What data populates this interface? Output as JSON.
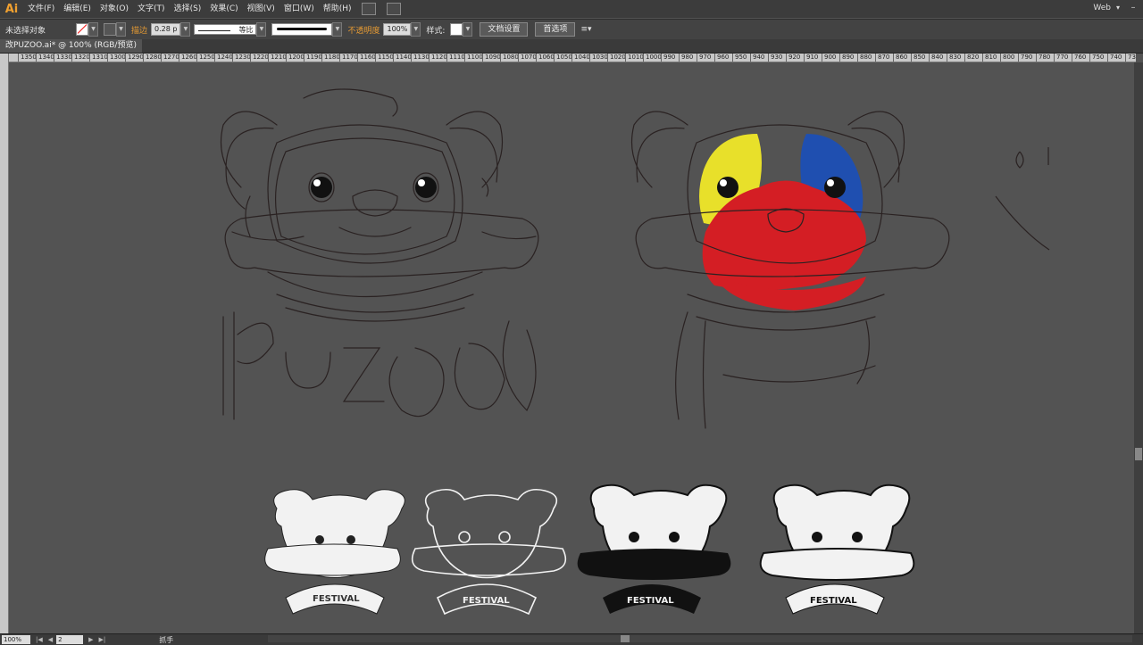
{
  "app": {
    "logo": "Ai",
    "workspace": "Web"
  },
  "menu": [
    "文件(F)",
    "编辑(E)",
    "对象(O)",
    "文字(T)",
    "选择(S)",
    "效果(C)",
    "视图(V)",
    "窗口(W)",
    "帮助(H)"
  ],
  "control": {
    "selection": "未选择对象",
    "stroke_label": "描边",
    "stroke_weight": "0.28 p",
    "profile": "等比",
    "opacity_label": "不透明度",
    "opacity_value": "100%",
    "style_label": "样式:",
    "doc_setup": "文档设置",
    "prefs": "首选项"
  },
  "document": {
    "tab": "改PUZOO.ai* @ 100% (RGB/预览)"
  },
  "ruler": {
    "start": 1350,
    "step": 10,
    "labels": [
      1350,
      1340,
      1330,
      1320,
      1310,
      1300,
      1290,
      1280,
      1270,
      1260,
      1250,
      1240,
      1230,
      1220,
      1210,
      1200,
      1190,
      1180,
      1170,
      1160,
      1150,
      1140,
      1130,
      1120,
      1110,
      1100,
      1090,
      1080,
      1070,
      1060,
      1050,
      1040,
      1030,
      1020,
      1010,
      1000,
      990,
      980,
      970,
      960,
      950,
      940,
      930,
      920,
      910,
      900,
      890,
      880,
      870,
      860,
      850,
      840,
      830,
      820,
      810,
      800,
      790,
      780,
      770,
      760,
      750,
      740,
      730
    ]
  },
  "canvas": {
    "sketch_lettering": "PUZOO",
    "stamp_text": "FESTIVAL",
    "colors": {
      "yellow": "#e8e02a",
      "blue": "#1f4fb0",
      "red": "#d41e24",
      "line": "#2a2222"
    }
  },
  "status": {
    "zoom": "100%",
    "page": "2",
    "tool": "抓手"
  }
}
